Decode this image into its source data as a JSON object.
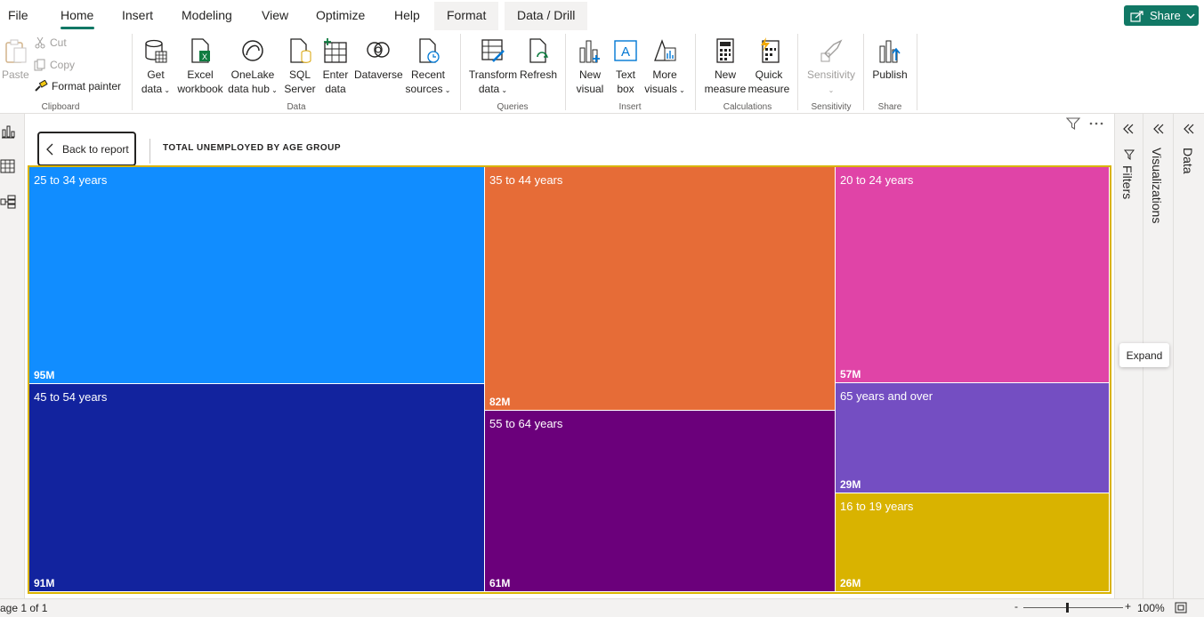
{
  "menu": {
    "file": "File",
    "home": "Home",
    "insert": "Insert",
    "modeling": "Modeling",
    "view": "View",
    "optimize": "Optimize",
    "help": "Help",
    "format": "Format",
    "data_drill": "Data / Drill",
    "share": "Share"
  },
  "ribbon": {
    "clipboard": {
      "paste": "Paste",
      "cut": "Cut",
      "copy": "Copy",
      "format_painter": "Format painter",
      "group": "Clipboard"
    },
    "data": {
      "get_data_1": "Get",
      "get_data_2": "data",
      "excel_1": "Excel",
      "excel_2": "workbook",
      "onelake_1": "OneLake",
      "onelake_2": "data hub",
      "sql_1": "SQL",
      "sql_2": "Server",
      "enter_1": "Enter",
      "enter_2": "data",
      "dataverse": "Dataverse",
      "recent_1": "Recent",
      "recent_2": "sources",
      "group": "Data"
    },
    "queries": {
      "transform_1": "Transform",
      "transform_2": "data",
      "refresh": "Refresh",
      "group": "Queries"
    },
    "insert": {
      "new_visual_1": "New",
      "new_visual_2": "visual",
      "text_box_1": "Text",
      "text_box_2": "box",
      "more_visuals_1": "More",
      "more_visuals_2": "visuals",
      "group": "Insert"
    },
    "calculations": {
      "new_measure_1": "New",
      "new_measure_2": "measure",
      "quick_measure_1": "Quick",
      "quick_measure_2": "measure",
      "group": "Calculations"
    },
    "sensitivity": {
      "label": "Sensitivity",
      "group": "Sensitivity"
    },
    "share": {
      "publish": "Publish",
      "group": "Share"
    }
  },
  "canvas": {
    "back_button": "Back to report",
    "visual_title": "TOTAL UNEMPLOYED BY AGE GROUP"
  },
  "chart_data": {
    "type": "treemap",
    "title": "TOTAL UNEMPLOYED BY AGE GROUP",
    "categories": [
      "25 to 34 years",
      "45 to 54 years",
      "35 to 44 years",
      "55 to 64 years",
      "20 to 24 years",
      "65 years and over",
      "16 to 19 years"
    ],
    "value_labels": [
      "95M",
      "91M",
      "82M",
      "61M",
      "57M",
      "29M",
      "26M"
    ],
    "values": [
      95,
      91,
      82,
      61,
      57,
      29,
      26
    ],
    "colors": [
      "#118dff",
      "#12239e",
      "#e66c37",
      "#6b007b",
      "#e044a7",
      "#744ec2",
      "#d9b300"
    ]
  },
  "panes": {
    "filters": "Filters",
    "visualizations": "Visualizations",
    "data": "Data",
    "expand_tooltip": "Expand"
  },
  "status": {
    "page": "age 1 of 1",
    "zoom": "100%",
    "minus": "-",
    "plus": "+"
  }
}
